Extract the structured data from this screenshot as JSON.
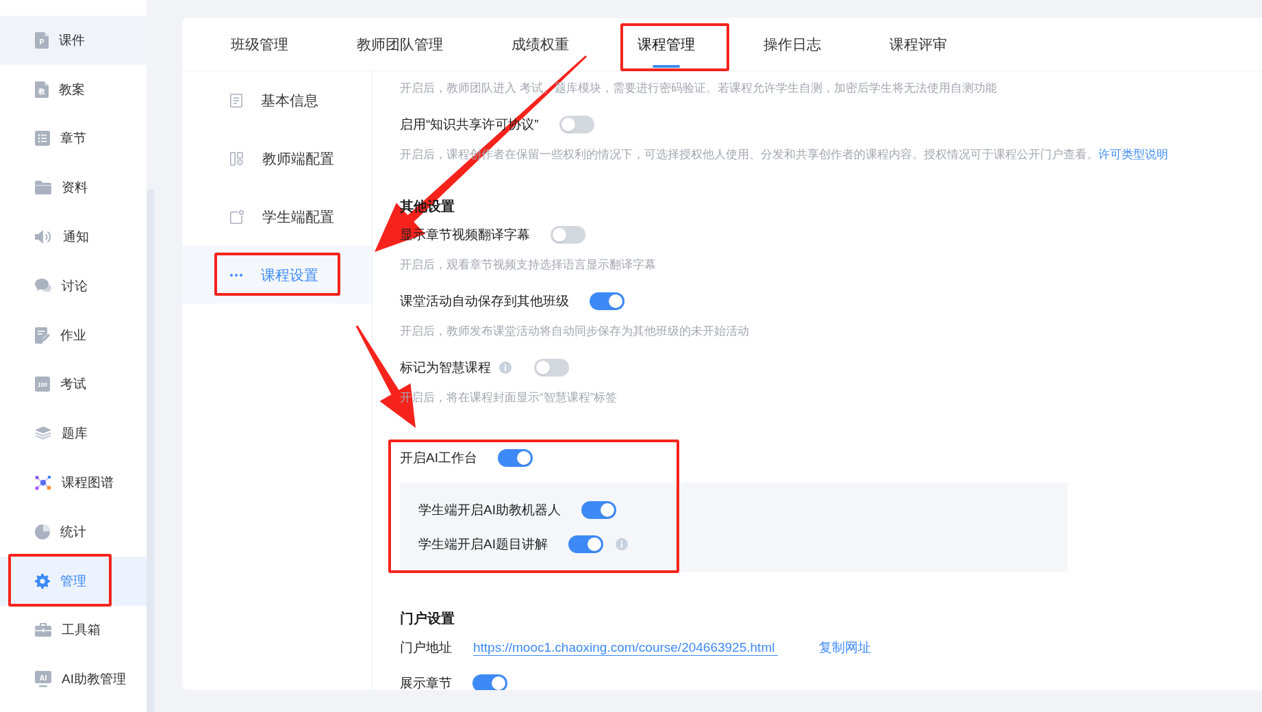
{
  "sidebar": {
    "items": [
      {
        "label": "课件",
        "icon_text": "P",
        "selected": false,
        "hovered": true,
        "marked": false
      },
      {
        "label": "教案",
        "icon_text": "教",
        "selected": false,
        "hovered": false,
        "marked": false
      },
      {
        "label": "章节",
        "selected": false,
        "hovered": false,
        "marked": false
      },
      {
        "label": "资料",
        "selected": false,
        "hovered": false,
        "marked": false
      },
      {
        "label": "通知",
        "selected": false,
        "hovered": false,
        "marked": false
      },
      {
        "label": "讨论",
        "selected": false,
        "hovered": false,
        "marked": false
      },
      {
        "label": "作业",
        "selected": false,
        "hovered": false,
        "marked": false
      },
      {
        "label": "考试",
        "icon_text": "100",
        "selected": false,
        "hovered": false,
        "marked": false
      },
      {
        "label": "题库",
        "selected": false,
        "hovered": false,
        "marked": false
      },
      {
        "label": "课程图谱",
        "selected": false,
        "hovered": false,
        "marked": false
      },
      {
        "label": "统计",
        "selected": false,
        "hovered": false,
        "marked": false
      },
      {
        "label": "管理",
        "selected": true,
        "hovered": false,
        "marked": true
      },
      {
        "label": "工具箱",
        "selected": false,
        "hovered": false,
        "marked": false
      },
      {
        "label": "AI助教管理",
        "icon_text": "AI",
        "selected": false,
        "hovered": false,
        "marked": false
      }
    ]
  },
  "tabs": [
    {
      "label": "班级管理",
      "selected": false,
      "marked": false
    },
    {
      "label": "教师团队管理",
      "selected": false,
      "marked": false
    },
    {
      "label": "成绩权重",
      "selected": false,
      "marked": false
    },
    {
      "label": "课程管理",
      "selected": true,
      "marked": true
    },
    {
      "label": "操作日志",
      "selected": false,
      "marked": false
    },
    {
      "label": "课程评审",
      "selected": false,
      "marked": false
    }
  ],
  "submenu": {
    "items": [
      {
        "label": "基本信息",
        "selected": false,
        "marked": false
      },
      {
        "label": "教师端配置",
        "selected": false,
        "marked": false
      },
      {
        "label": "学生端配置",
        "selected": false,
        "marked": false
      },
      {
        "label": "课程设置",
        "selected": true,
        "marked": true
      }
    ]
  },
  "content": [
    {
      "kind": "note",
      "text": "开启后，教师团队进入 考试、题库模块，需要进行密码验证。若课程允许学生自测，加密后学生将无法使用自测功能"
    },
    {
      "kind": "toggle",
      "label": "启用“知识共享许可协议”",
      "on": false
    },
    {
      "kind": "note",
      "text": "开启后，课程创作者在保留一些权利的情况下，可选择授权他人使用、分发和共享创作者的课程内容。授权情况可于课程公开门户查看。",
      "link": "许可类型说明"
    },
    {
      "kind": "heading",
      "text": "其他设置"
    },
    {
      "kind": "toggle",
      "label": "显示章节视频翻译字幕",
      "on": false
    },
    {
      "kind": "note",
      "text": "开启后，观看章节视频支持选择语言显示翻译字幕"
    },
    {
      "kind": "toggle",
      "label": "课堂活动自动保存到其他班级",
      "on": true
    },
    {
      "kind": "note",
      "text": "开启后，教师发布课堂活动将自动同步保存为其他班级的未开始活动"
    },
    {
      "kind": "toggle",
      "label": "标记为智慧课程",
      "on": false,
      "info_before": true
    },
    {
      "kind": "note",
      "text": "开启后，将在课程封面显示“智慧课程”标签"
    },
    {
      "kind": "group",
      "label": "开启AI工作台",
      "on": true,
      "marked": true,
      "items": [
        {
          "label": "学生端开启AI助教机器人",
          "on": true
        },
        {
          "label": "学生端开启AI题目讲解",
          "on": true,
          "info_after": true
        }
      ]
    },
    {
      "kind": "heading",
      "text": "门户设置"
    },
    {
      "kind": "address",
      "label": "门户地址",
      "url": "https://mooc1.chaoxing.com/course/204663925.html",
      "action": "复制网址"
    },
    {
      "kind": "toggle",
      "label": "展示章节",
      "on": true
    }
  ]
}
